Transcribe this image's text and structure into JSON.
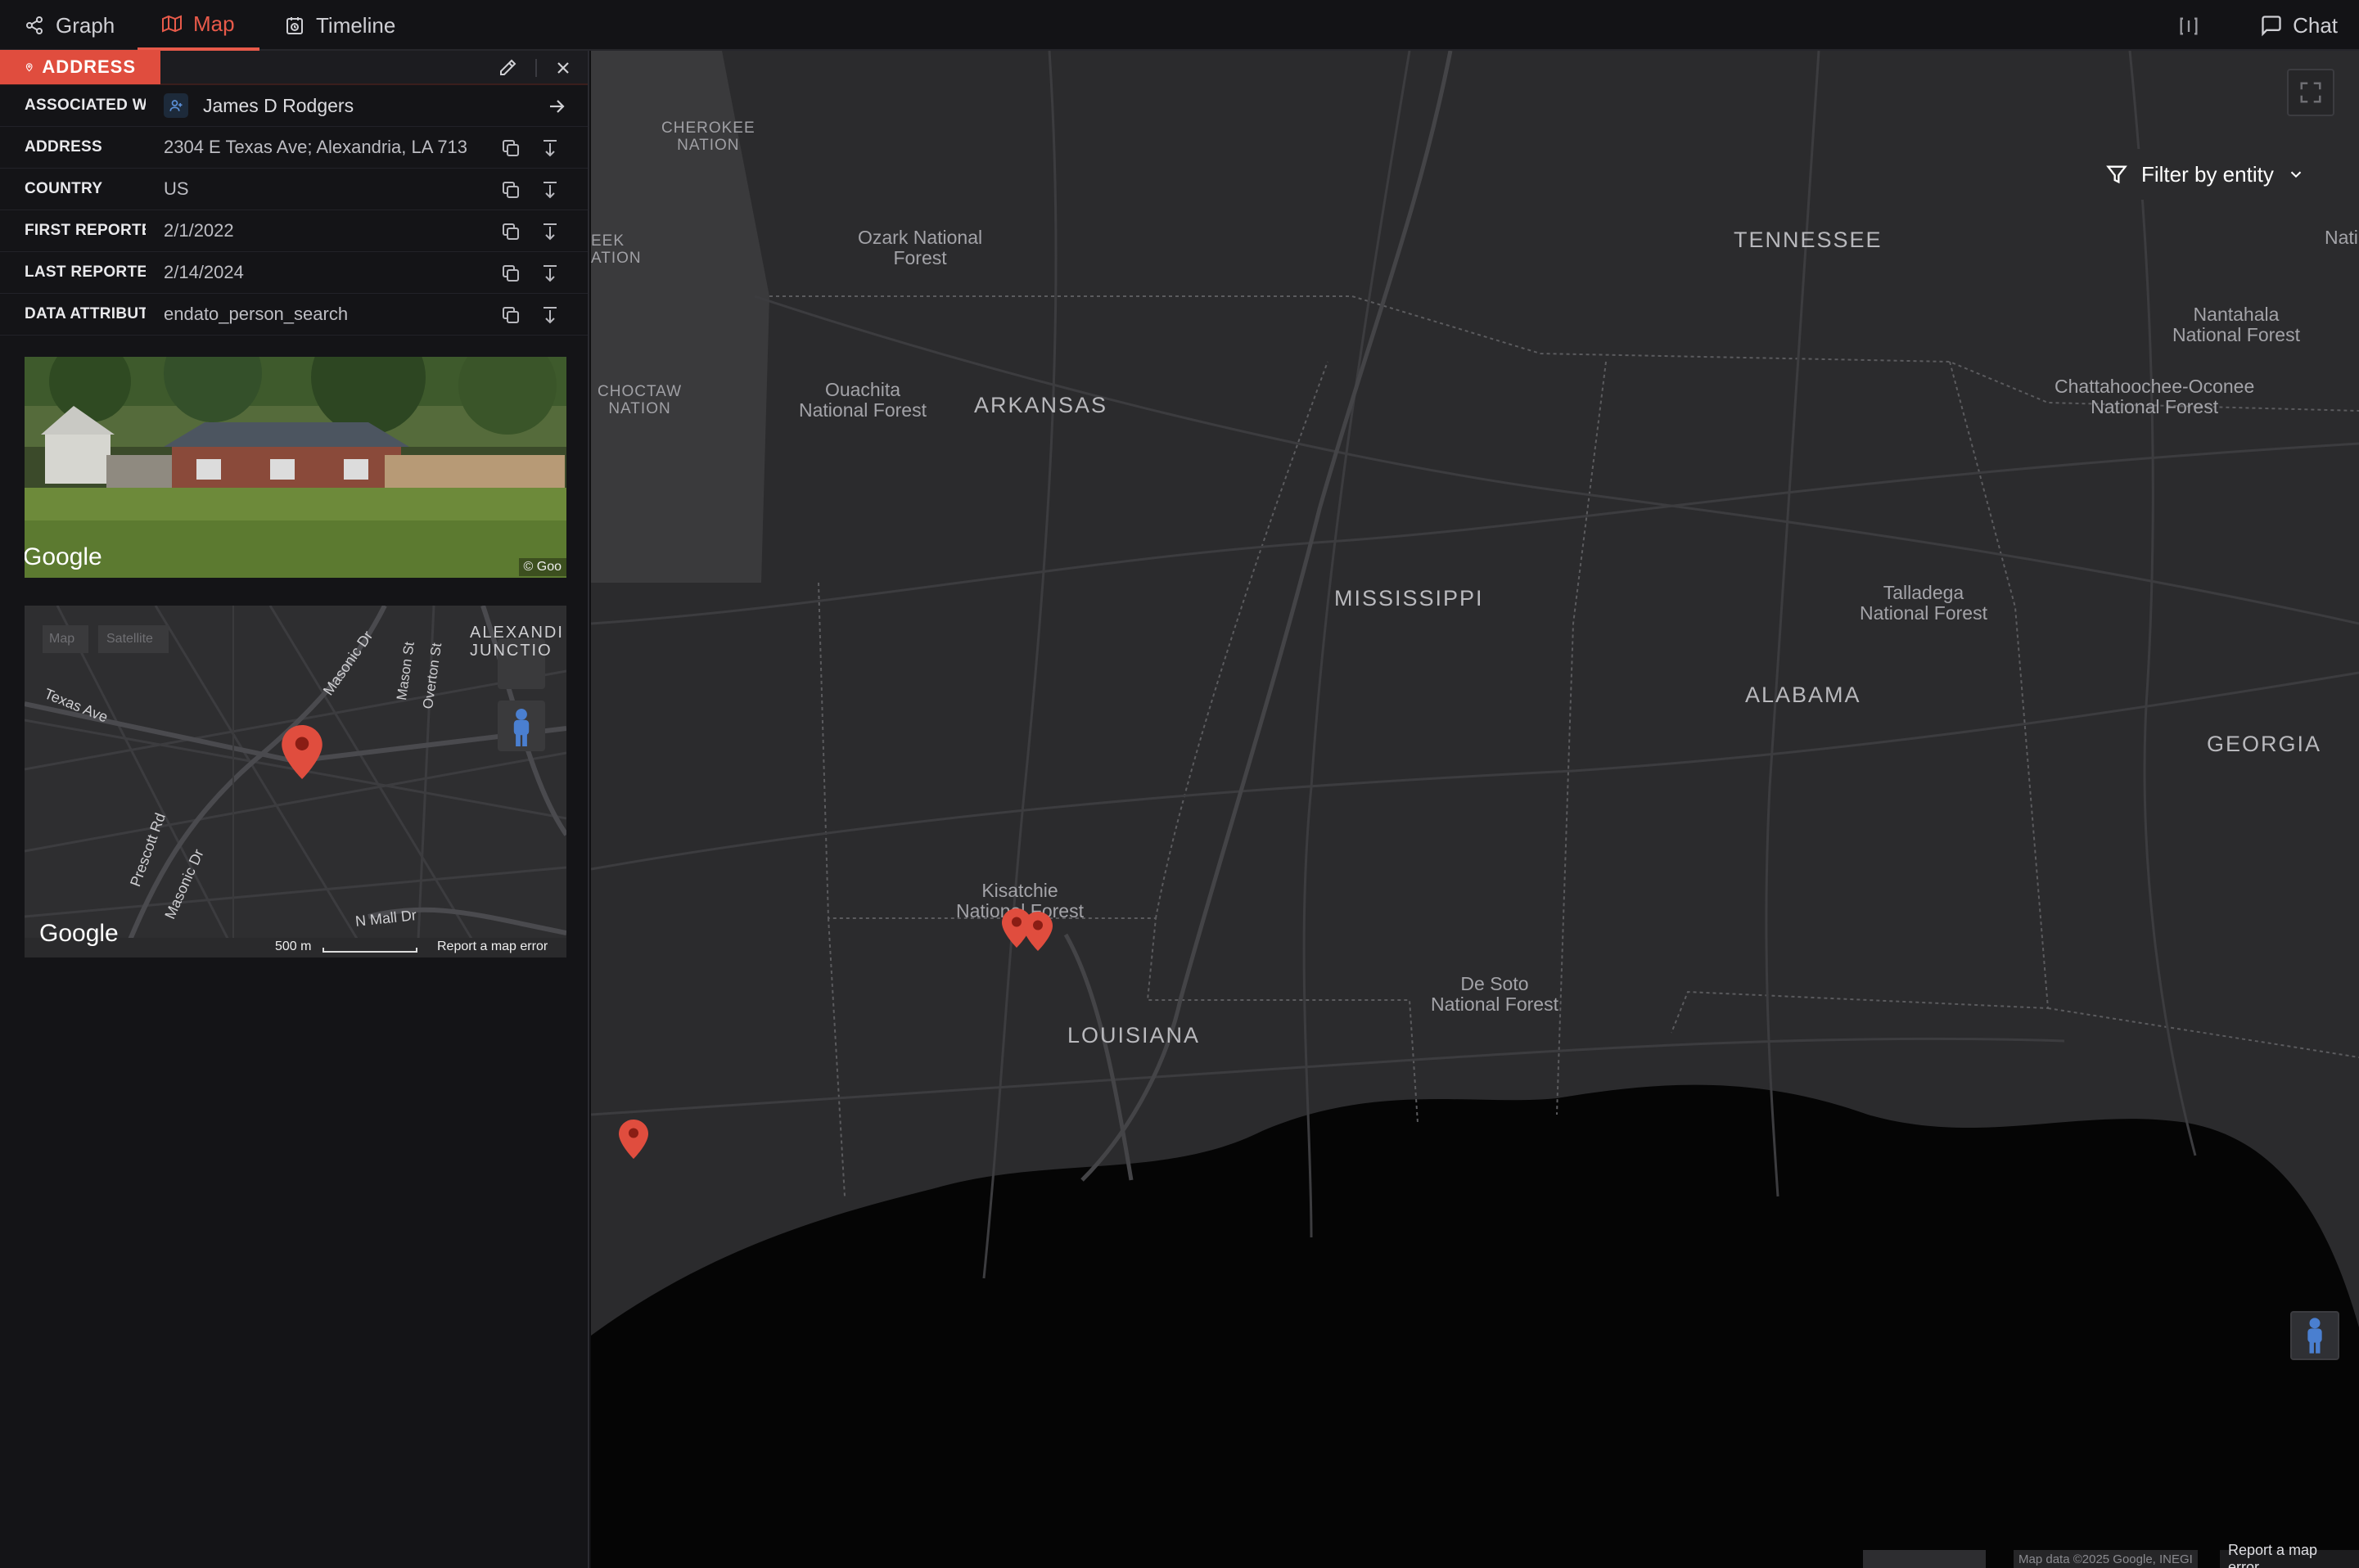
{
  "tabs": [
    {
      "label": "Graph",
      "icon": "graph-icon"
    },
    {
      "label": "Map",
      "icon": "map-icon",
      "active": true
    },
    {
      "label": "Timeline",
      "icon": "timeline-icon"
    }
  ],
  "topbar": {
    "chat_label": "Chat",
    "panel_toggle_icon": "panel-toggle-icon"
  },
  "panel": {
    "entity_type": "ADDRESS",
    "rows": [
      {
        "key": "ASSOCIATED WITH",
        "key_display": "ASSOCIATED WI",
        "value": "James D Rodgers"
      },
      {
        "key": "ADDRESS",
        "key_display": "ADDRESS",
        "value": "2304 E Texas Ave; Alexandria, LA 713"
      },
      {
        "key": "COUNTRY",
        "key_display": "COUNTRY",
        "value": "US"
      },
      {
        "key": "FIRST REPORTED",
        "key_display": "FIRST REPORTED",
        "value": "2/1/2022"
      },
      {
        "key": "LAST REPORTED",
        "key_display": "LAST REPORTED",
        "value": "2/14/2024"
      },
      {
        "key": "DATA ATTRIBUTION",
        "key_display": "DATA ATTRIBUTI",
        "value": "endato_person_search"
      }
    ],
    "streetview": {
      "logo": "Google",
      "copyright": "© Goo"
    },
    "minimap": {
      "streets": [
        "Texas Ave",
        "Masonic Dr",
        "Mason St",
        "Overton St",
        "Prescott Rd",
        "Masonic Dr",
        "N Mall Dr"
      ],
      "area_label": "ALEXANDRIA JUNCTION",
      "area_label_line1": "ALEXANDI",
      "area_label_line2": "JUNCTIO",
      "map_btn": "Map",
      "sat_btn": "Satellite",
      "logo": "Google",
      "scale": "500 m",
      "report": "Report a map error"
    }
  },
  "map": {
    "filter_label": "Filter by entity",
    "states": [
      "ARKANSAS",
      "TENNESSEE",
      "MISSISSIPPI",
      "ALABAMA",
      "GEORGIA",
      "LOUISIANA"
    ],
    "forests": [
      {
        "l1": "Ozark National",
        "l2": "Forest"
      },
      {
        "l1": "Ouachita",
        "l2": "National Forest"
      },
      {
        "l1": "Kisatchie",
        "l2": "National Forest"
      },
      {
        "l1": "De Soto",
        "l2": "National Forest"
      },
      {
        "l1": "Nantahala",
        "l2": "National Forest"
      },
      {
        "l1": "Chattahoochee-Oconee",
        "l2": "National Forest"
      },
      {
        "l1": "Talladega",
        "l2": "National Forest"
      }
    ],
    "nations": [
      {
        "l1": "CHEROKEE",
        "l2": "NATION"
      },
      {
        "l1": "CHOCTAW",
        "l2": "NATION"
      },
      {
        "l1": "EEK",
        "l2": "ATION"
      }
    ],
    "edge_label": "Nati",
    "attribution": "Map data ©2025 Google, INEGI",
    "report": "Report a map error",
    "pin_color": "#e04d3e"
  }
}
